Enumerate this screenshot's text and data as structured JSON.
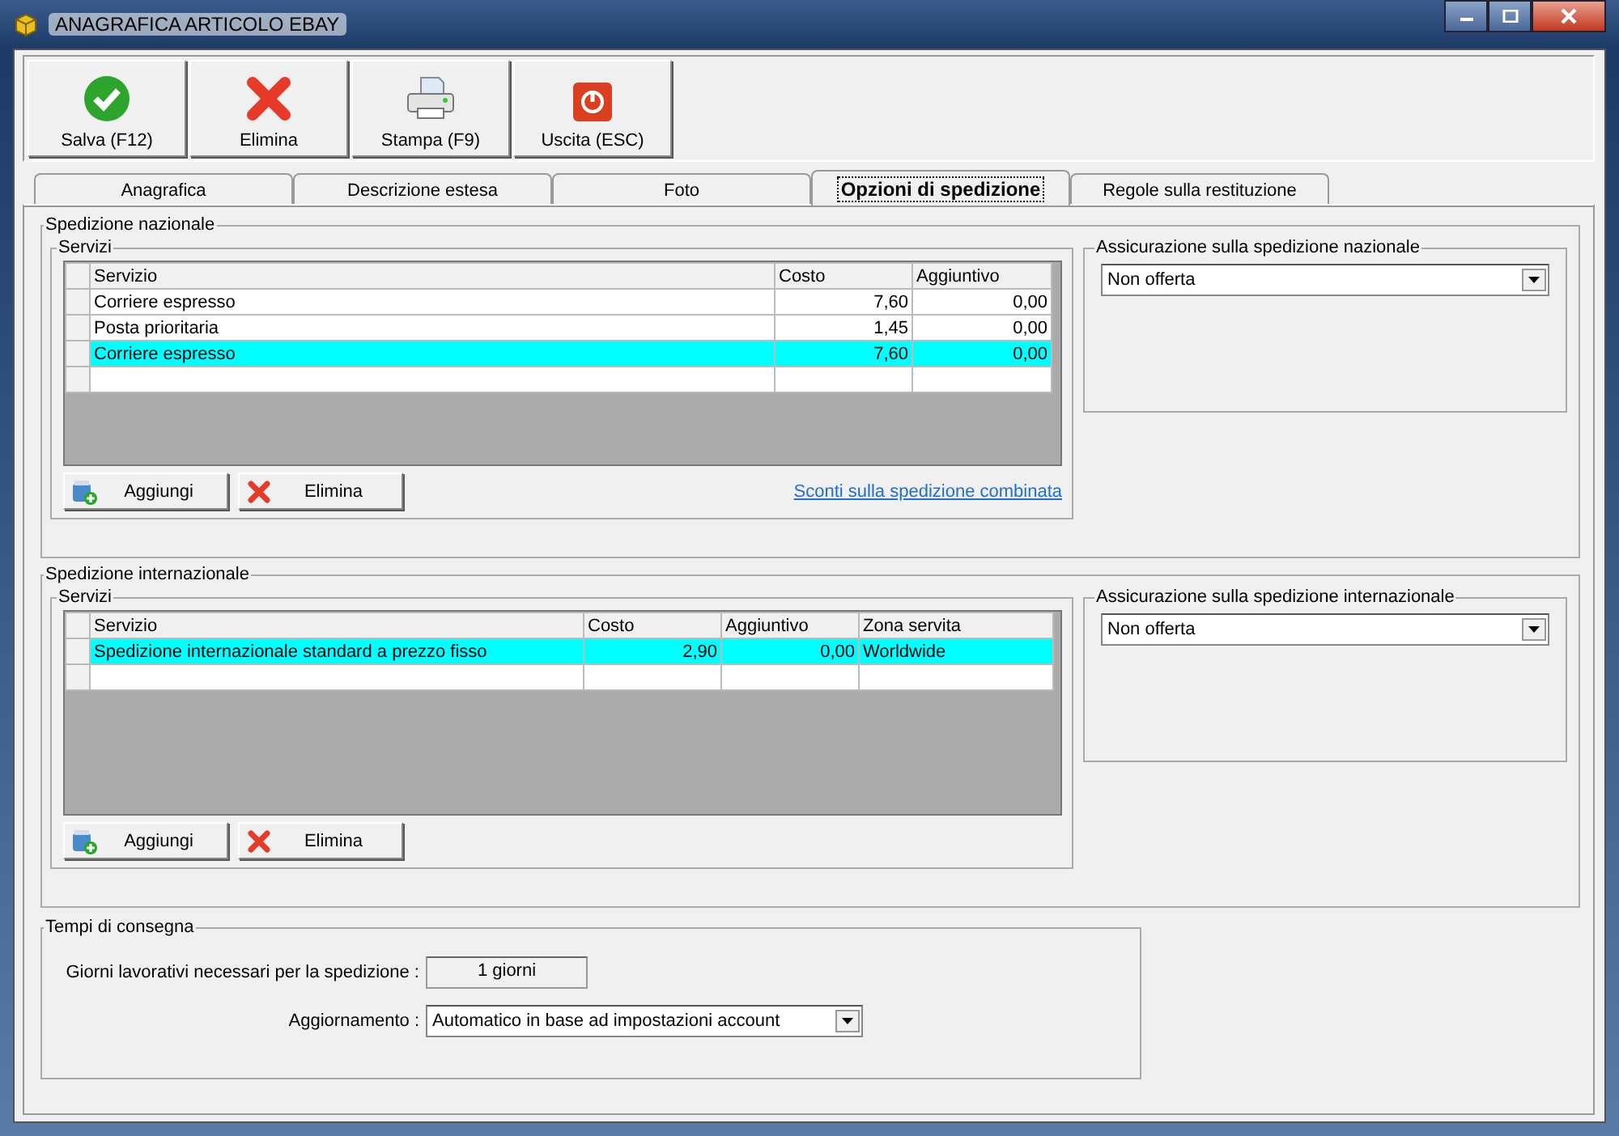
{
  "window": {
    "title": "ANAGRAFICA ARTICOLO EBAY"
  },
  "toolbar": [
    {
      "label": "Salva (F12)",
      "kind": "save"
    },
    {
      "label": "Elimina",
      "kind": "delete"
    },
    {
      "label": "Stampa (F9)",
      "kind": "print"
    },
    {
      "label": "Uscita (ESC)",
      "kind": "exit"
    }
  ],
  "tabs": [
    {
      "label": "Anagrafica",
      "selected": false
    },
    {
      "label": "Descrizione estesa",
      "selected": false
    },
    {
      "label": "Foto",
      "selected": false
    },
    {
      "label": "Opzioni di spedizione",
      "selected": true
    },
    {
      "label": "Regole sulla restituzione",
      "selected": false
    }
  ],
  "sections": [
    {
      "title": "Spedizione nazionale",
      "services": {
        "title": "Servizi",
        "columns": [
          {
            "label": "Servizio",
            "numeric": false
          },
          {
            "label": "Costo",
            "numeric": true
          },
          {
            "label": "Aggiuntivo",
            "numeric": true
          }
        ],
        "rows": [
          {
            "cells": [
              "Corriere espresso",
              "7,60",
              "0,00"
            ],
            "selected": false
          },
          {
            "cells": [
              "Posta prioritaria",
              "1,45",
              "0,00"
            ],
            "selected": false
          },
          {
            "cells": [
              "Corriere espresso",
              "7,60",
              "0,00"
            ],
            "selected": true
          }
        ]
      },
      "buttons": [
        {
          "label": "Aggiungi",
          "kind": "add"
        },
        {
          "label": "Elimina",
          "kind": "delete"
        }
      ],
      "link": "Sconti sulla spedizione combinata",
      "insurance": {
        "title": "Assicurazione sulla spedizione nazionale",
        "value": "Non offerta"
      }
    },
    {
      "title": "Spedizione internazionale",
      "services": {
        "title": "Servizi",
        "columns": [
          {
            "label": "Servizio",
            "numeric": false
          },
          {
            "label": "Costo",
            "numeric": true
          },
          {
            "label": "Aggiuntivo",
            "numeric": true
          },
          {
            "label": "Zona servita",
            "numeric": false
          }
        ],
        "rows": [
          {
            "cells": [
              "Spedizione internazionale standard a prezzo fisso",
              "2,90",
              "0,00",
              "Worldwide"
            ],
            "selected": true
          }
        ]
      },
      "buttons": [
        {
          "label": "Aggiungi",
          "kind": "add"
        },
        {
          "label": "Elimina",
          "kind": "delete"
        }
      ],
      "insurance": {
        "title": "Assicurazione sulla spedizione internazionale",
        "value": "Non offerta"
      }
    }
  ],
  "delivery": {
    "title": "Tempi di consegna",
    "days_label": "Giorni lavorativi necessari per la spedizione :",
    "days_value": "1 giorni",
    "update_label": "Aggiornamento :",
    "update_value": "Automatico in base ad impostazioni account"
  }
}
